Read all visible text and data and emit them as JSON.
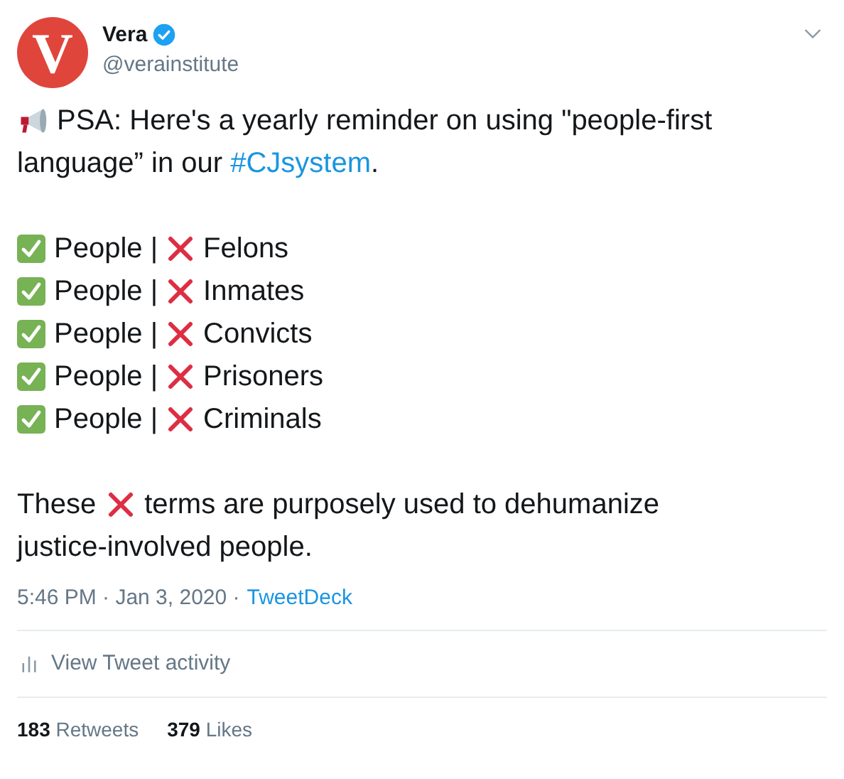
{
  "author": {
    "avatar_letter": "V",
    "name": "Vera",
    "verified": true,
    "handle": "@verainstitute"
  },
  "intro": {
    "line_1": "PSA: Here's a yearly reminder on using \"people-first",
    "line_2": "language” in our",
    "hashtag": "#CJsystem",
    "text_after": "."
  },
  "rows": [
    {
      "good": "People |",
      "bad": "Felons"
    },
    {
      "good": "People |",
      "bad": "Inmates"
    },
    {
      "good": "People |",
      "bad": "Convicts"
    },
    {
      "good": "People |",
      "bad": "Prisoners"
    },
    {
      "good": "People |",
      "bad": "Criminals"
    }
  ],
  "closing": {
    "before": "These",
    "after": "terms are purposely used to dehumanize",
    "line_2": "justice-involved people."
  },
  "meta": {
    "time": "5:46 PM · Jan 3, 2020 ·",
    "source": "TweetDeck"
  },
  "activity": "View Tweet activity",
  "stats": [
    {
      "count": "183",
      "label": "Retweets"
    },
    {
      "count": "379",
      "label": "Likes"
    }
  ]
}
